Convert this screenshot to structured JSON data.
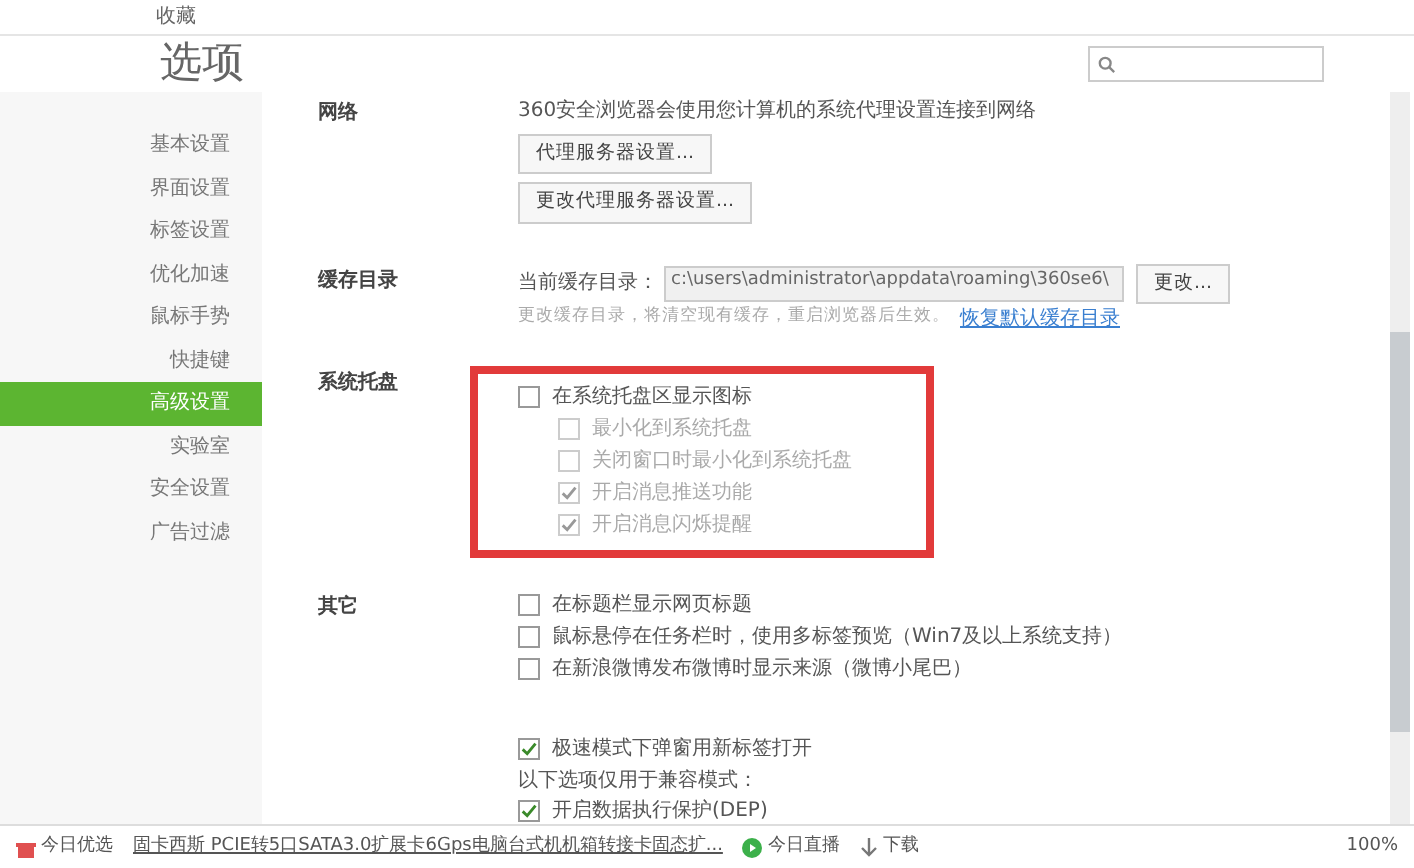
{
  "bookmarks_bar": {
    "items": [
      "收藏"
    ]
  },
  "header": {
    "title": "选项"
  },
  "sidebar": {
    "items": [
      {
        "label": "基本设置",
        "selected": false
      },
      {
        "label": "界面设置",
        "selected": false
      },
      {
        "label": "标签设置",
        "selected": false
      },
      {
        "label": "优化加速",
        "selected": false
      },
      {
        "label": "鼠标手势",
        "selected": false
      },
      {
        "label": "快捷键",
        "selected": false
      },
      {
        "label": "高级设置",
        "selected": true
      },
      {
        "label": "实验室",
        "selected": false
      },
      {
        "label": "安全设置",
        "selected": false
      },
      {
        "label": "广告过滤",
        "selected": false
      }
    ]
  },
  "sections": [
    {
      "label": "网络",
      "items": [
        {
          "kind": "text",
          "text": "360安全浏览器会使用您计算机的系统代理设置连接到网络"
        },
        {
          "kind": "button",
          "text": "代理服务器设置..."
        },
        {
          "kind": "button",
          "text": "更改代理服务器设置..."
        }
      ]
    },
    {
      "label": "缓存目录",
      "items": [
        {
          "kind": "path",
          "label": "当前缓存目录：",
          "value": "c:\\users\\administrator\\appdata\\roaming\\360se6\\",
          "button": "更改..."
        },
        {
          "kind": "hint",
          "text": "更改缓存目录，将清空现有缓存，重启浏览器后生效。",
          "link": "恢复默认缓存目录"
        }
      ]
    },
    {
      "label": "系统托盘",
      "highlighted": true,
      "items": [
        {
          "kind": "checkbox",
          "text": "在系统托盘区显示图标",
          "checked": false,
          "disabled": false,
          "children": [
            {
              "text": "最小化到系统托盘",
              "checked": false,
              "disabled": true
            },
            {
              "text": "关闭窗口时最小化到系统托盘",
              "checked": false,
              "disabled": true
            },
            {
              "text": "开启消息推送功能",
              "checked": true,
              "disabled": true
            },
            {
              "text": "开启消息闪烁提醒",
              "checked": true,
              "disabled": true
            }
          ]
        }
      ]
    },
    {
      "label": "其它",
      "highlighted": false,
      "items": [
        {
          "kind": "checkbox",
          "text": "在标题栏显示网页标题",
          "checked": false,
          "disabled": false
        },
        {
          "kind": "checkbox",
          "text": "鼠标悬停在任务栏时，使用多标签预览（Win7及以上系统支持）",
          "checked": false,
          "disabled": false
        },
        {
          "kind": "checkbox",
          "text": "在新浪微博发布微博时显示来源（微博小尾巴）",
          "checked": false,
          "disabled": false
        },
        {
          "kind": "spacer"
        },
        {
          "kind": "checkbox",
          "text": "极速模式下弹窗用新标签打开",
          "checked": true,
          "disabled": false
        },
        {
          "kind": "text",
          "text": "以下选项仅用于兼容模式："
        },
        {
          "kind": "checkbox",
          "text": "开启数据执行保护(DEP)",
          "checked": true,
          "disabled": false
        }
      ]
    }
  ],
  "status_bar": {
    "left": "今日优选",
    "news": "固卡西斯 PCIE转5口SATA3.0扩展卡6Gps电脑台式机机箱转接卡固态扩...",
    "live": "今日直播",
    "download": "下载",
    "zoom": "100%"
  }
}
